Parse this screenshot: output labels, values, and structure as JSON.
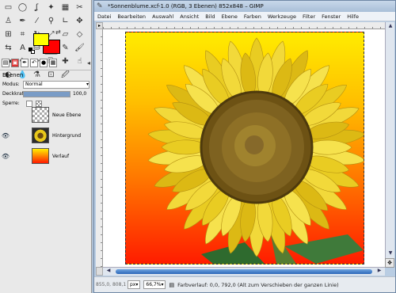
{
  "toolbox": {
    "tools": [
      {
        "name": "rect-select-tool-icon",
        "glyph": "▭"
      },
      {
        "name": "ellipse-select-tool-icon",
        "glyph": "◯"
      },
      {
        "name": "free-select-tool-icon",
        "glyph": "ʆ"
      },
      {
        "name": "fuzzy-select-tool-icon",
        "glyph": "✦"
      },
      {
        "name": "select-by-color-tool-icon",
        "glyph": "▦"
      },
      {
        "name": "scissors-tool-icon",
        "glyph": "✂"
      },
      {
        "name": "foreground-select-tool-icon",
        "glyph": "♙"
      },
      {
        "name": "paths-tool-icon",
        "glyph": "✒"
      },
      {
        "name": "color-picker-tool-icon",
        "glyph": "⁄"
      },
      {
        "name": "zoom-tool-icon",
        "glyph": "⚲"
      },
      {
        "name": "measure-tool-icon",
        "glyph": "∟"
      },
      {
        "name": "move-tool-icon",
        "glyph": "✥"
      },
      {
        "name": "align-tool-icon",
        "glyph": "⊞"
      },
      {
        "name": "crop-tool-icon",
        "glyph": "⌗"
      },
      {
        "name": "rotate-tool-icon",
        "glyph": "↻"
      },
      {
        "name": "scale-tool-icon",
        "glyph": "⤢"
      },
      {
        "name": "shear-tool-icon",
        "glyph": "▱"
      },
      {
        "name": "perspective-tool-icon",
        "glyph": "◇"
      },
      {
        "name": "flip-tool-icon",
        "glyph": "⇆"
      },
      {
        "name": "text-tool-icon",
        "glyph": "A"
      },
      {
        "name": "bucket-fill-tool-icon",
        "glyph": "⛁"
      },
      {
        "name": "blend-tool-icon",
        "glyph": "▤"
      },
      {
        "name": "pencil-tool-icon",
        "glyph": "✎"
      },
      {
        "name": "paintbrush-tool-icon",
        "glyph": "🖌"
      },
      {
        "name": "eraser-tool-icon",
        "glyph": "▬"
      },
      {
        "name": "airbrush-tool-icon",
        "glyph": "✈"
      },
      {
        "name": "ink-tool-icon",
        "glyph": "✑"
      },
      {
        "name": "clone-tool-icon",
        "glyph": "⎘"
      },
      {
        "name": "heal-tool-icon",
        "glyph": "✚"
      },
      {
        "name": "smudge-tool-icon",
        "glyph": "☝"
      },
      {
        "name": "dodge-burn-tool-icon",
        "glyph": "◐"
      },
      {
        "name": "blur-tool-icon",
        "glyph": "💧"
      },
      {
        "name": "eyedropper-tool-icon",
        "glyph": "⚗"
      },
      {
        "name": "clone-perspective-tool-icon",
        "glyph": "⊡"
      },
      {
        "name": "brush-tool-icon",
        "glyph": "🖉"
      }
    ],
    "active_tool_index": 21,
    "foreground_color": "#ffff00",
    "background_color": "#ff0000"
  },
  "layers_panel": {
    "title": "Ebenen",
    "mode_label": "Modus:",
    "mode_value": "Normal",
    "opacity_label": "Deckkraft:",
    "opacity_value": "100,0",
    "opacity_fraction": 1.0,
    "lock_label": "Sperre:",
    "layers": [
      {
        "name": "Neue Ebene",
        "visible": false
      },
      {
        "name": "Hintergrund",
        "visible": true
      },
      {
        "name": "Verlauf",
        "visible": true
      }
    ]
  },
  "image_window": {
    "title": "*Sonnenblume.xcf-1.0 (RGB, 3 Ebenen) 852x848 – GIMP",
    "menu": [
      "Datei",
      "Bearbeiten",
      "Auswahl",
      "Ansicht",
      "Bild",
      "Ebene",
      "Farben",
      "Werkzeuge",
      "Filter",
      "Fenster",
      "Hilfe"
    ]
  },
  "statusbar": {
    "coords": "855,0, 808,1",
    "unit": "px",
    "zoom": "66,7%",
    "text": "Farbverlauf: 0,0, 792,0 (Alt zum Verschieben der ganzen Linie)"
  },
  "colors": {
    "window_accent": "#2a67b8",
    "gradient_top": "#ffec00",
    "gradient_bottom": "#ff1c00"
  }
}
